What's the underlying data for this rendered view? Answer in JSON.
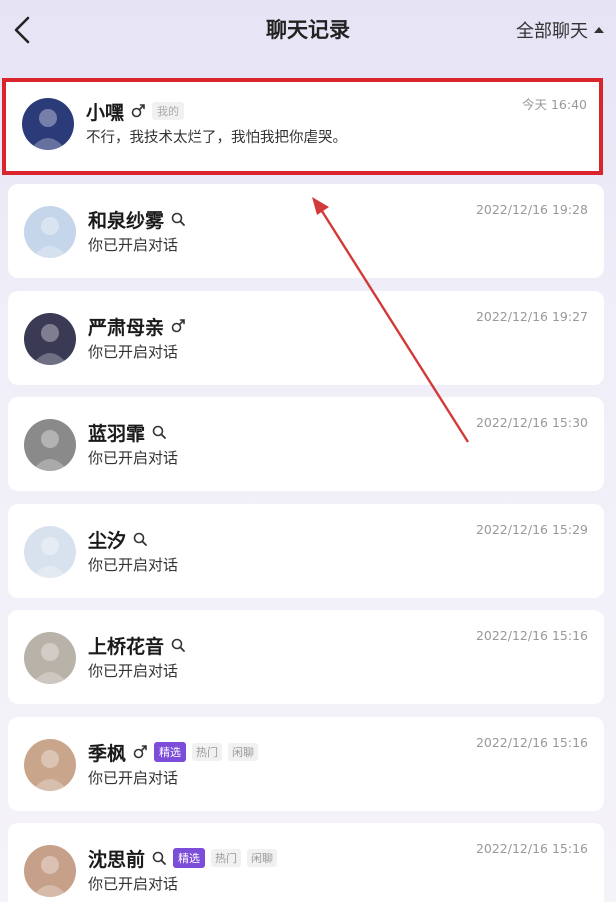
{
  "header": {
    "title": "聊天记录",
    "filter_label": "全部聊天"
  },
  "chats": [
    {
      "name": "小嘿",
      "gender": "male",
      "tags": [
        {
          "type": "mine",
          "label": "我的"
        }
      ],
      "time": "今天 16:40",
      "message": "不行，我技术太烂了，我怕我把你虐哭。",
      "highlighted": true,
      "avatar_color": "#2b3b7a"
    },
    {
      "name": "和泉纱雾",
      "gender": "search",
      "tags": [],
      "time": "2022/12/16 19:28",
      "message": "你已开启对话",
      "highlighted": false,
      "avatar_color": "#c6d6ea"
    },
    {
      "name": "严肃母亲",
      "gender": "male",
      "tags": [],
      "time": "2022/12/16 19:27",
      "message": "你已开启对话",
      "highlighted": false,
      "avatar_color": "#3a3a55"
    },
    {
      "name": "蓝羽霏",
      "gender": "search",
      "tags": [],
      "time": "2022/12/16 15:30",
      "message": "你已开启对话",
      "highlighted": false,
      "avatar_color": "#8a8a8a"
    },
    {
      "name": "尘汐",
      "gender": "search",
      "tags": [],
      "time": "2022/12/16 15:29",
      "message": "你已开启对话",
      "highlighted": false,
      "avatar_color": "#d8e2ee"
    },
    {
      "name": "上桥花音",
      "gender": "search",
      "tags": [],
      "time": "2022/12/16 15:16",
      "message": "你已开启对话",
      "highlighted": false,
      "avatar_color": "#b9b2a8"
    },
    {
      "name": "季枫",
      "gender": "male",
      "tags": [
        {
          "type": "featured",
          "label": "精选"
        },
        {
          "type": "plain",
          "label": "热门"
        },
        {
          "type": "plain",
          "label": "闲聊"
        }
      ],
      "time": "2022/12/16 15:16",
      "message": "你已开启对话",
      "highlighted": false,
      "avatar_color": "#c9a58c"
    },
    {
      "name": "沈思前",
      "gender": "search",
      "tags": [
        {
          "type": "featured",
          "label": "精选"
        },
        {
          "type": "plain",
          "label": "热门"
        },
        {
          "type": "plain",
          "label": "闲聊"
        }
      ],
      "time": "2022/12/16 15:16",
      "message": "你已开启对话",
      "highlighted": false,
      "avatar_color": "#c7a08a"
    }
  ],
  "colors": {
    "highlight_border": "#d9252b",
    "featured_tag": "#7c4dd8",
    "arrow": "#d23a3a"
  },
  "icons": {
    "back": "chevron-left-icon",
    "male": "male-gender-icon",
    "search": "search-icon"
  }
}
